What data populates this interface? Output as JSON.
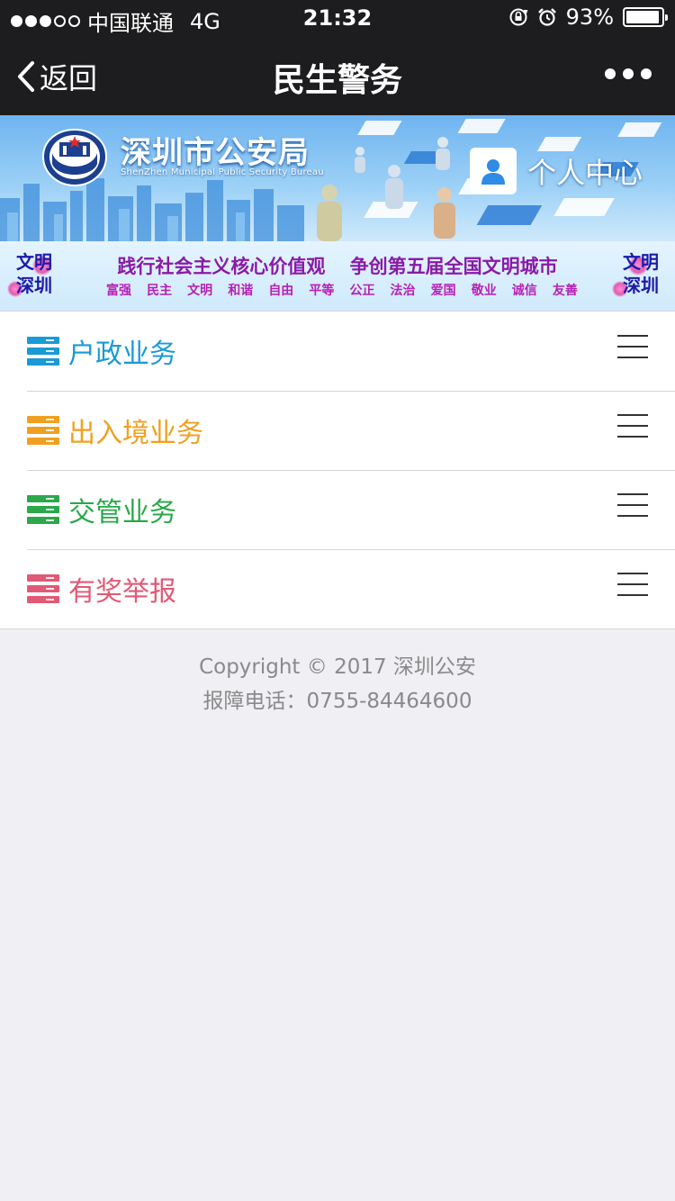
{
  "status_bar": {
    "carrier": "中国联通",
    "network": "4G",
    "time": "21:32",
    "battery": "93%",
    "battery_level": 0.93,
    "signal_bars_filled": 3,
    "signal_bars_total": 5
  },
  "nav": {
    "back_label": "返回",
    "title": "民生警务"
  },
  "banner": {
    "org_name": "深圳市公安局",
    "org_name_en": "ShenZhen Municipal Public Security Bureau",
    "user_center_label": "个人中心"
  },
  "slogan": {
    "badge_line1": "文明",
    "badge_line2": "深圳",
    "main_left": "践行社会主义核心价值观",
    "main_right": "争创第五届全国文明城市",
    "values": [
      "富强",
      "民主",
      "文明",
      "和谐",
      "自由",
      "平等",
      "公正",
      "法治",
      "爱国",
      "敬业",
      "诚信",
      "友善"
    ]
  },
  "menu": [
    {
      "label": "户政业务",
      "color": "#1a9ad6"
    },
    {
      "label": "出入境业务",
      "color": "#f0a020"
    },
    {
      "label": "交管业务",
      "color": "#2aa84a"
    },
    {
      "label": "有奖举报",
      "color": "#e05a75"
    }
  ],
  "footer": {
    "copyright": "Copyright © 2017 深圳公安",
    "phone": "报障电话：0755-84464600"
  }
}
